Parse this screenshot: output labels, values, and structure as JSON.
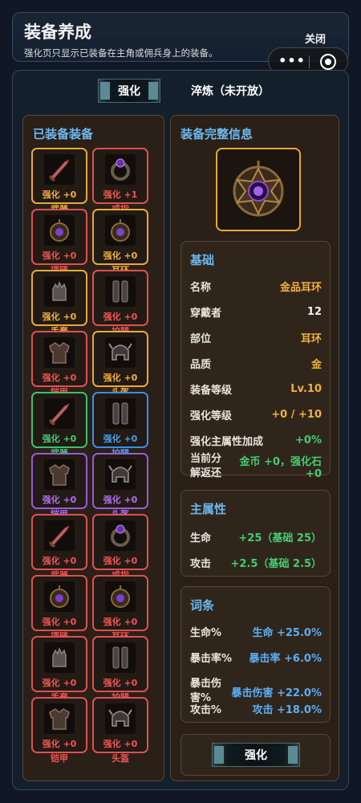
{
  "header": {
    "title": "装备养成",
    "subtitle": "强化页只显示已装备在主角或佣兵身上的装备。",
    "close_label": "关闭"
  },
  "capsule": {
    "more_label": "•••"
  },
  "tabs": [
    {
      "label": "强化",
      "active": true
    },
    {
      "label": "淬炼（未开放）",
      "active": false
    }
  ],
  "equipped": {
    "title": "已装备装备",
    "items": [
      {
        "level": "强化 +0",
        "slot": "武器",
        "quality": "gold",
        "icon": "sword"
      },
      {
        "level": "强化 +1",
        "slot": "戒指",
        "quality": "red",
        "icon": "ring"
      },
      {
        "level": "强化 +0",
        "slot": "项链",
        "quality": "red",
        "icon": "amulet"
      },
      {
        "level": "强化 +0",
        "slot": "耳环",
        "quality": "gold",
        "icon": "amulet"
      },
      {
        "level": "强化 +0",
        "slot": "手套",
        "quality": "gold",
        "icon": "gauntlet"
      },
      {
        "level": "强化 +0",
        "slot": "护腿",
        "quality": "red",
        "icon": "greaves"
      },
      {
        "level": "强化 +0",
        "slot": "铠甲",
        "quality": "red",
        "icon": "armor"
      },
      {
        "level": "强化 +0",
        "slot": "头盔",
        "quality": "gold",
        "icon": "helmet"
      },
      {
        "level": "强化 +0",
        "slot": "武器",
        "quality": "green",
        "icon": "sword"
      },
      {
        "level": "强化 +0",
        "slot": "护腿",
        "quality": "blue",
        "icon": "greaves"
      },
      {
        "level": "强化 +0",
        "slot": "铠甲",
        "quality": "purple",
        "icon": "armor"
      },
      {
        "level": "强化 +0",
        "slot": "头盔",
        "quality": "purple",
        "icon": "helmet"
      },
      {
        "level": "强化 +0",
        "slot": "武器",
        "quality": "red",
        "icon": "sword"
      },
      {
        "level": "强化 +0",
        "slot": "戒指",
        "quality": "red",
        "icon": "ring"
      },
      {
        "level": "强化 +0",
        "slot": "项链",
        "quality": "red",
        "icon": "amulet"
      },
      {
        "level": "强化 +0",
        "slot": "耳环",
        "quality": "red",
        "icon": "amulet"
      },
      {
        "level": "强化 +0",
        "slot": "手套",
        "quality": "red",
        "icon": "gauntlet"
      },
      {
        "level": "强化 +0",
        "slot": "护腿",
        "quality": "red",
        "icon": "greaves"
      },
      {
        "level": "强化 +0",
        "slot": "铠甲",
        "quality": "red",
        "icon": "armor"
      },
      {
        "level": "强化 +0",
        "slot": "头盔",
        "quality": "red",
        "icon": "helmet"
      }
    ]
  },
  "detail": {
    "title": "装备完整信息",
    "item_icon": "amulet",
    "base": {
      "title": "基础",
      "rows": [
        {
          "k": "名称",
          "v": "金品耳环",
          "color": "gold"
        },
        {
          "k": "穿戴者",
          "v": "12",
          "color": "white"
        },
        {
          "k": "部位",
          "v": "耳环",
          "color": "gold"
        },
        {
          "k": "品质",
          "v": "金",
          "color": "gold"
        },
        {
          "k": "装备等级",
          "v": "Lv.10",
          "color": "gold"
        },
        {
          "k": "强化等级",
          "v": "+0 / +10",
          "color": "gold"
        },
        {
          "k": "强化主属性加成",
          "v": "+0%",
          "color": "green"
        },
        {
          "k": "当前分解返还",
          "v": "金币 +0，强化石 +0",
          "color": "green"
        }
      ]
    },
    "main_attr": {
      "title": "主属性",
      "rows": [
        {
          "k": "生命",
          "v": "+25（基础 25）",
          "color": "green"
        },
        {
          "k": "攻击",
          "v": "+2.5（基础 2.5）",
          "color": "green"
        }
      ]
    },
    "affixes": {
      "title": "词条",
      "rows": [
        {
          "k": "生命%",
          "v": "生命 +25.0%",
          "color": "blue"
        },
        {
          "k": "暴击率%",
          "v": "暴击率 +6.0%",
          "color": "blue"
        },
        {
          "k": "暴击伤害%",
          "v": "暴击伤害 +22.0%",
          "color": "blue"
        },
        {
          "k": "攻击%",
          "v": "攻击 +18.0%",
          "color": "blue"
        }
      ]
    },
    "enhance_button": "强化"
  }
}
